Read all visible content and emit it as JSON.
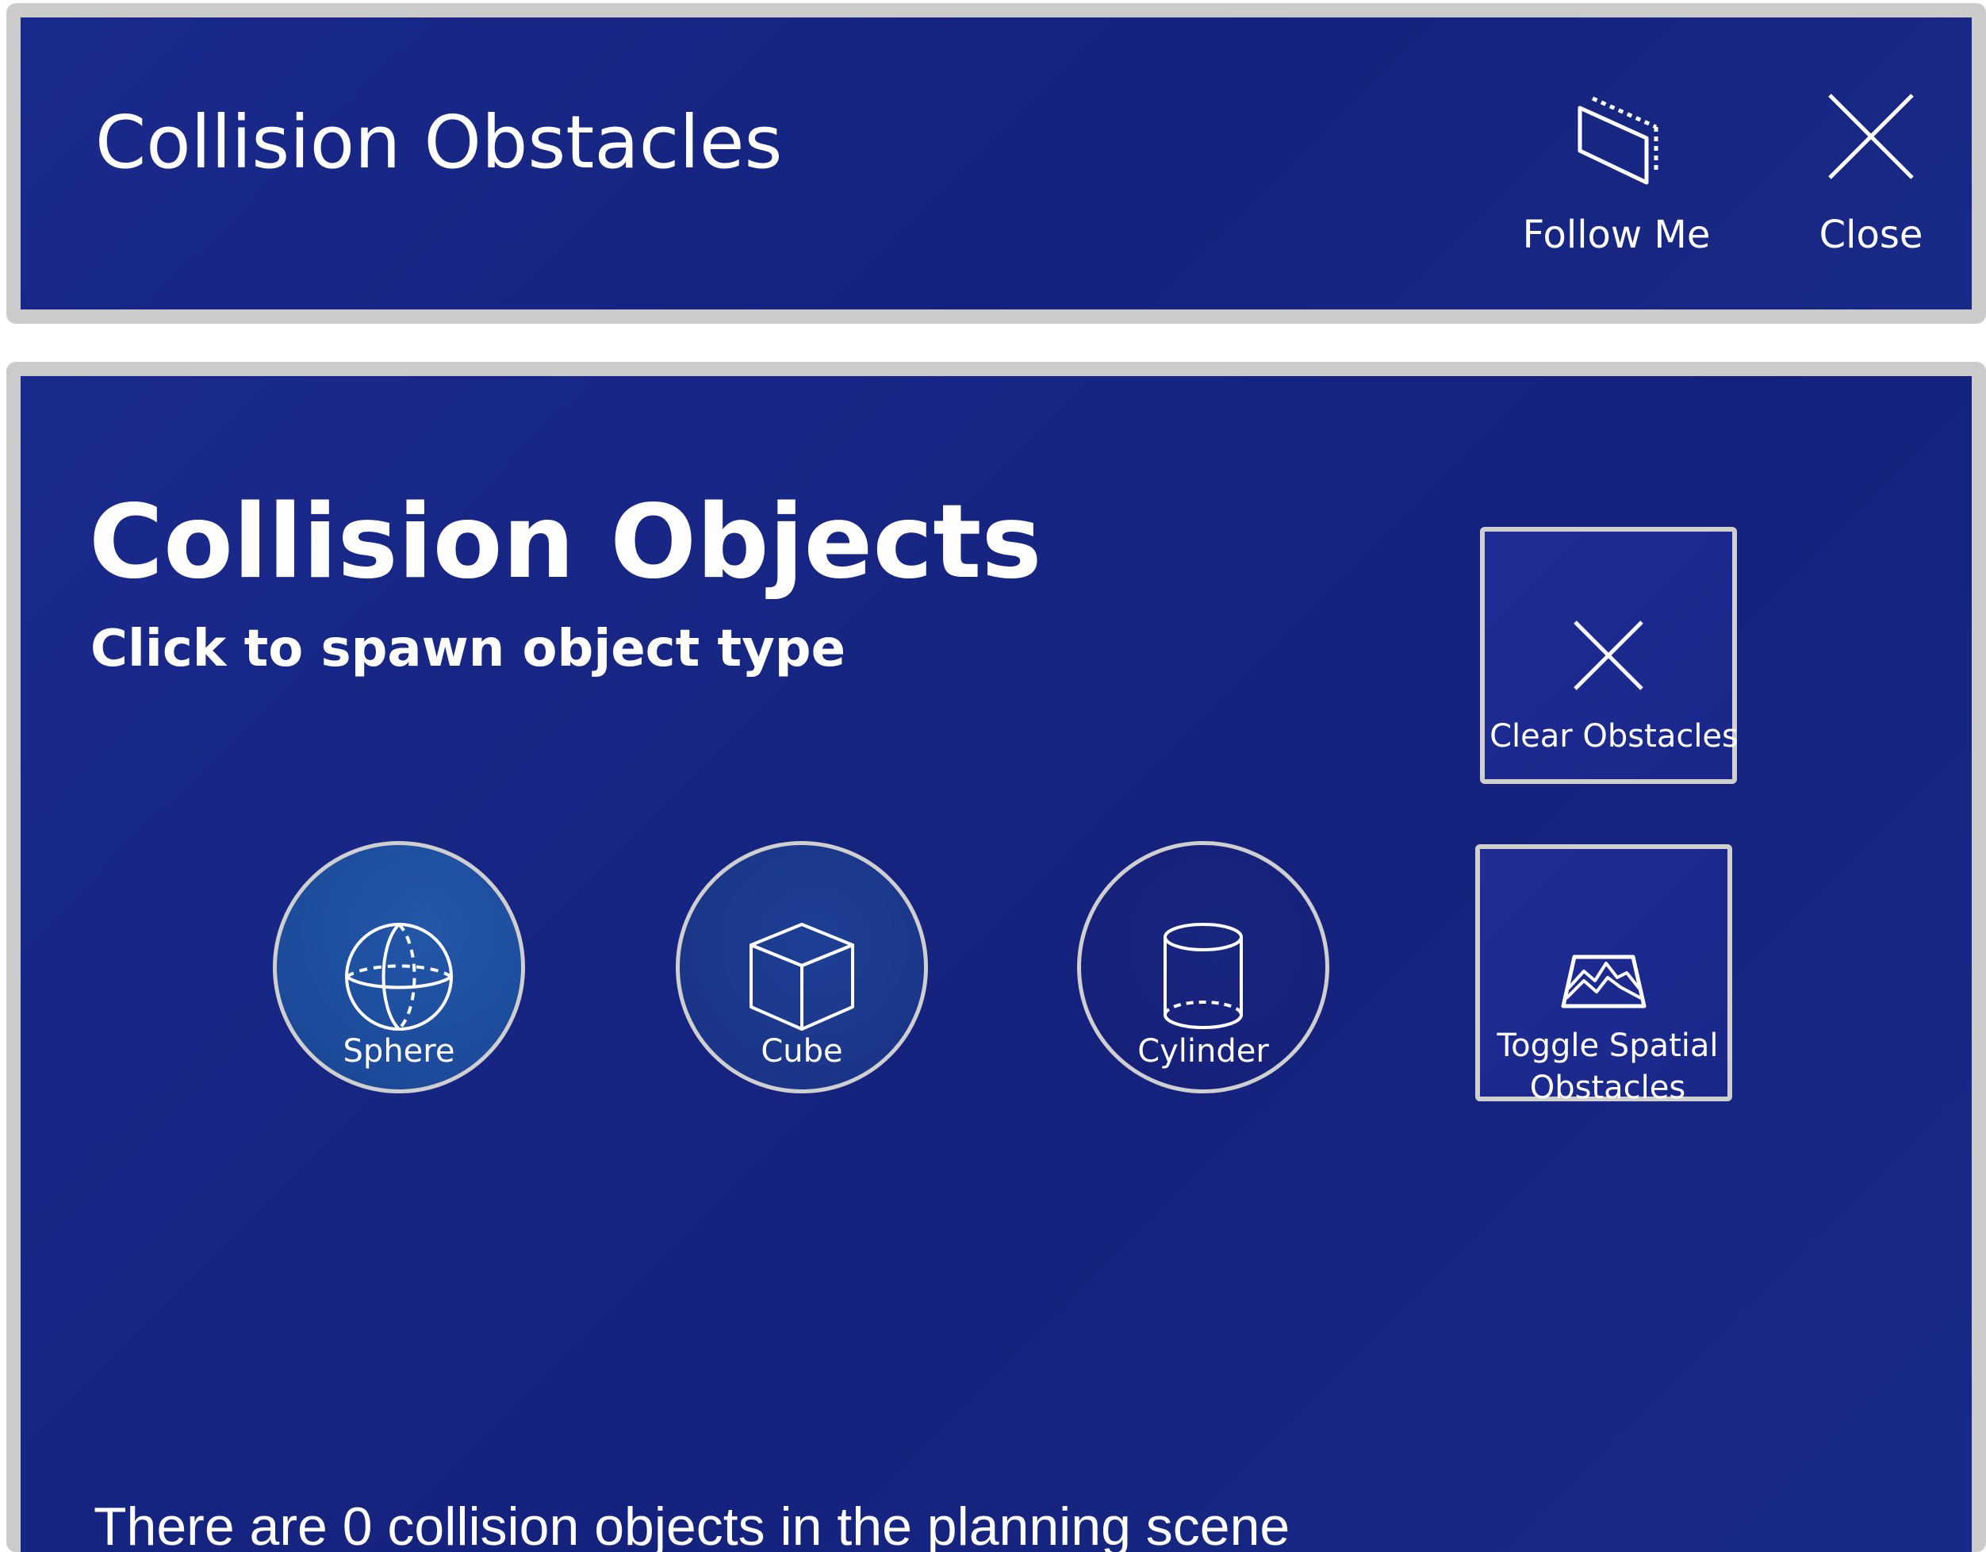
{
  "header": {
    "title": "Collision Obstacles",
    "follow_me": {
      "label": "Follow Me",
      "icon": "follow-me-icon"
    },
    "close": {
      "label": "Close",
      "icon": "close-icon"
    }
  },
  "main": {
    "title": "Collision Objects",
    "subtitle": "Click to spawn object type",
    "spawn_buttons": [
      {
        "label": "Sphere",
        "icon": "sphere-icon"
      },
      {
        "label": "Cube",
        "icon": "cube-icon"
      },
      {
        "label": "Cylinder",
        "icon": "cylinder-icon"
      }
    ],
    "clear_obstacles": {
      "label": "Clear Obstacles",
      "icon": "close-icon"
    },
    "toggle_spatial": {
      "label": "Toggle Spatial Obstacles",
      "icon": "spatial-map-icon"
    },
    "status": "There are 0 collision objects in the planning scene"
  },
  "colors": {
    "panel_background": "#17257f",
    "panel_border": "#cbcbcb",
    "text": "#ffffff"
  }
}
